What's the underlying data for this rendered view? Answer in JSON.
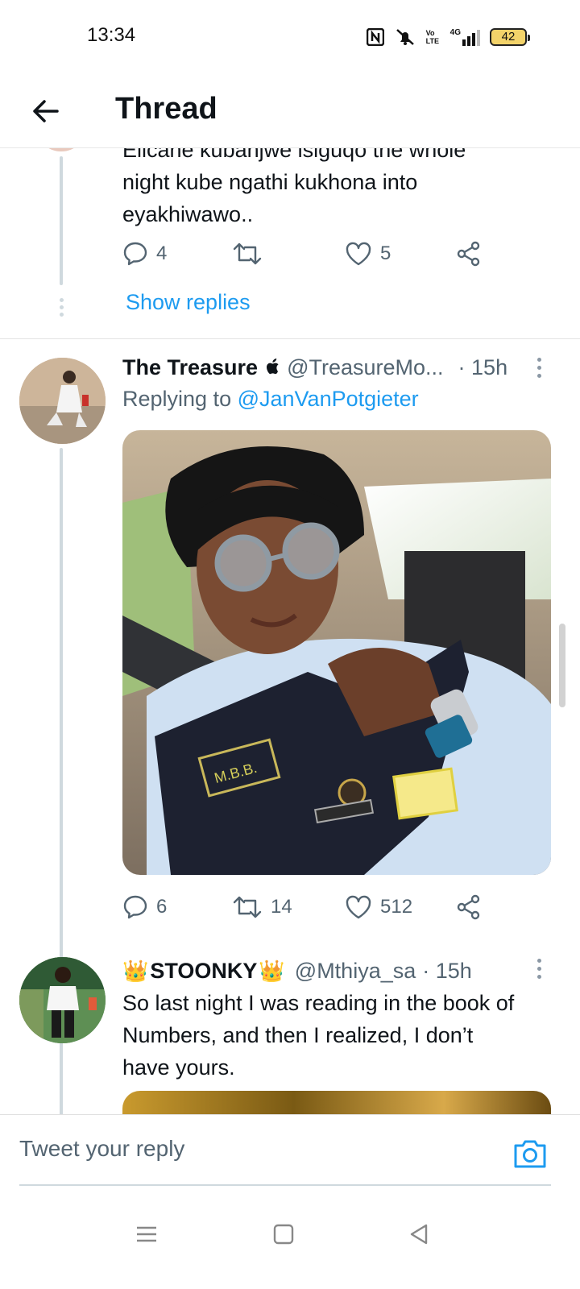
{
  "status_bar": {
    "time": "13:34",
    "network_label": "4G",
    "volte_label": "Vo LTE",
    "battery": "42"
  },
  "header": {
    "title": "Thread"
  },
  "partial_tweet": {
    "text_line1": "Elicane kubanjwe isiguqo the whole",
    "text_line2": "night kube ngathi kukhona into",
    "text_line3": "eyakhiwawo..",
    "reply_count": "4",
    "retweet_count": "",
    "like_count": "5",
    "show_replies": "Show replies"
  },
  "tweet_treasure": {
    "display_name": "The Treasure",
    "handle": "@TreasureMo...",
    "time": "· 15h",
    "replying_prefix": "Replying to",
    "replying_handle": "@JanVanPotgieter",
    "reply_count": "6",
    "retweet_count": "14",
    "like_count": "512"
  },
  "tweet_stoonky": {
    "display_name": "STOONKY",
    "handle": "@Mthiya_sa",
    "time": "· 15h",
    "text_line1": "So last night I was reading in the book of",
    "text_line2": "Numbers, and then I realized, I don’t",
    "text_line3": "have yours."
  },
  "reply_bar": {
    "placeholder": "Tweet your reply"
  },
  "colors": {
    "link": "#1d9bf0",
    "secondary_text": "#536471",
    "thread_line": "#cfd9de"
  }
}
